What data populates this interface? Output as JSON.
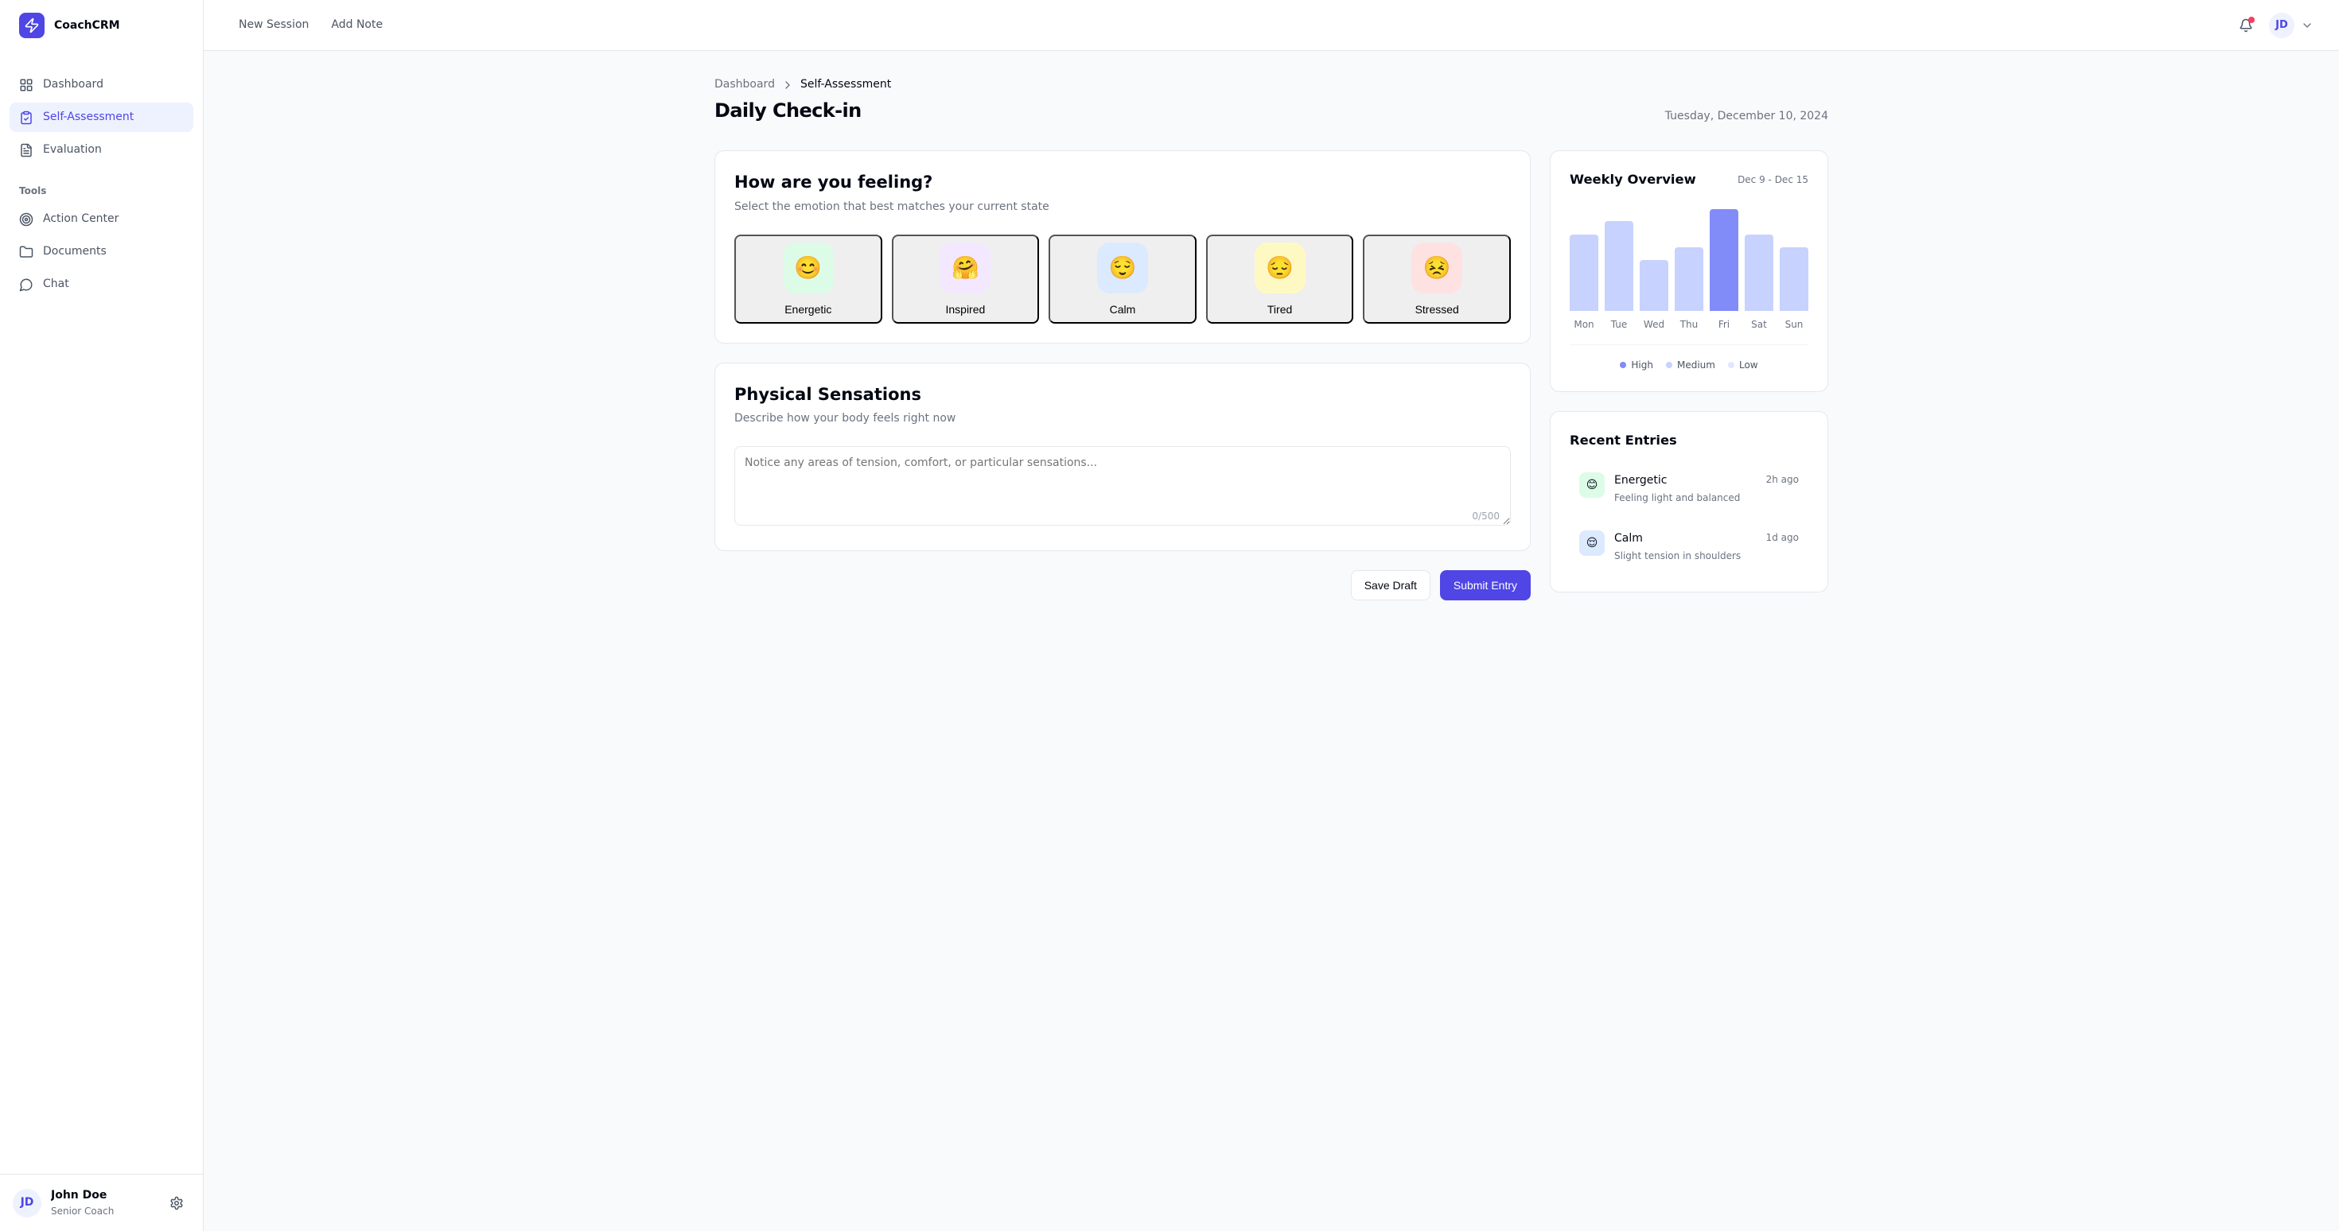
{
  "app": {
    "name": "CoachCRM"
  },
  "sidebar": {
    "items": [
      {
        "label": "Dashboard"
      },
      {
        "label": "Self-Assessment"
      },
      {
        "label": "Evaluation"
      }
    ],
    "tools_label": "Tools",
    "tools": [
      {
        "label": "Action Center"
      },
      {
        "label": "Documents"
      },
      {
        "label": "Chat"
      }
    ]
  },
  "user": {
    "name": "John Doe",
    "role": "Senior Coach",
    "initials": "JD"
  },
  "topbar": [
    "New Session",
    "Add Note"
  ],
  "breadcrumb": [
    "Dashboard",
    "Self-Assessment"
  ],
  "page": {
    "title": "Daily Check-in",
    "date": "Tuesday, December 10, 2024"
  },
  "feeling": {
    "title": "How are you feeling?",
    "desc": "Select the emotion that best matches your current state",
    "options": [
      {
        "label": "Energetic",
        "emoji": "😊",
        "bg": "#dcfce7"
      },
      {
        "label": "Inspired",
        "emoji": "🤗",
        "bg": "#f3e8ff"
      },
      {
        "label": "Calm",
        "emoji": "😌",
        "bg": "#dbeafe"
      },
      {
        "label": "Tired",
        "emoji": "😔",
        "bg": "#fef9c3"
      },
      {
        "label": "Stressed",
        "emoji": "😣",
        "bg": "#fee2e2"
      }
    ]
  },
  "physical": {
    "title": "Physical Sensations",
    "desc": "Describe how your body feels right now",
    "placeholder": "Notice any areas of tension, comfort, or particular sensations...",
    "counter": "0/500"
  },
  "actions": {
    "save": "Save Draft",
    "submit": "Submit Entry"
  },
  "overview": {
    "title": "Weekly Overview",
    "range": "Dec 9 - Dec 15",
    "legend": [
      {
        "label": "High",
        "color": "#818cf8"
      },
      {
        "label": "Medium",
        "color": "#c7d2fe"
      },
      {
        "label": "Low",
        "color": "#e0e7ff"
      }
    ]
  },
  "entries": {
    "title": "Recent Entries",
    "list": [
      {
        "emotion": "Energetic",
        "emoji": "😊",
        "bg": "#dcfce7",
        "time": "2h ago",
        "desc": "Feeling light and balanced"
      },
      {
        "emotion": "Calm",
        "emoji": "😌",
        "bg": "#dbeafe",
        "time": "1d ago",
        "desc": "Slight tension in shoulders"
      }
    ]
  },
  "chart_data": {
    "type": "bar",
    "title": "Weekly Overview",
    "xlabel": "",
    "ylabel": "",
    "ylim": [
      0,
      100
    ],
    "categories": [
      "Mon",
      "Tue",
      "Wed",
      "Thu",
      "Fri",
      "Sat",
      "Sun"
    ],
    "values": [
      75,
      88,
      50,
      62,
      100,
      75,
      62
    ],
    "colors": [
      "#c7d2fe",
      "#c7d2fe",
      "#c7d2fe",
      "#c7d2fe",
      "#818cf8",
      "#c7d2fe",
      "#c7d2fe"
    ]
  }
}
